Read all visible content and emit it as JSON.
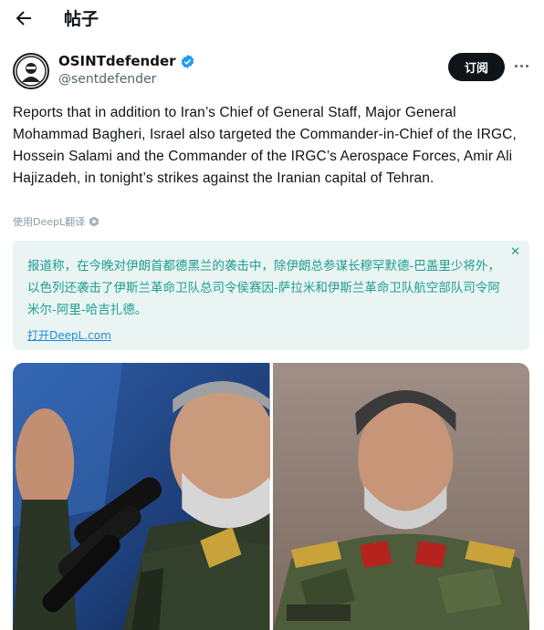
{
  "header": {
    "title": "帖子",
    "back_icon": "arrow-left-icon"
  },
  "author": {
    "name": "OSINTdefender",
    "handle": "@sentdefender",
    "verified_color": "#1d9bf0"
  },
  "actions": {
    "subscribe_label": "订阅",
    "more_icon": "more-horizontal-icon"
  },
  "tweet": {
    "text": "Reports that in addition to Iran’s Chief of General Staff, Major General Mohammad Bagheri, Israel also targeted the Commander-in-Chief of the IRGC, Hossein Salami and the Commander of the IRGC’s Aerospace Forces, Amir Ali Hajizadeh, in tonight’s strikes against the Iranian capital of Tehran.",
    "deepl_label": "使用DeepL翻译"
  },
  "translation": {
    "text": "报道称，在今晚对伊朗首都德黑兰的袭击中，除伊朗总参谋长穆罕默德-巴盖里少将外，以色列还袭击了伊斯兰革命卫队总司令侯赛因-萨拉米和伊斯兰革命卫队航空部队司令阿米尔-阿里-哈吉扎德。",
    "open_link": "打开DeepL.com",
    "close_icon": "close-icon"
  },
  "colors": {
    "accent_teal": "#1d9e8f",
    "translation_bg": "#eaf4f3",
    "link_blue": "#1d8cd6"
  }
}
